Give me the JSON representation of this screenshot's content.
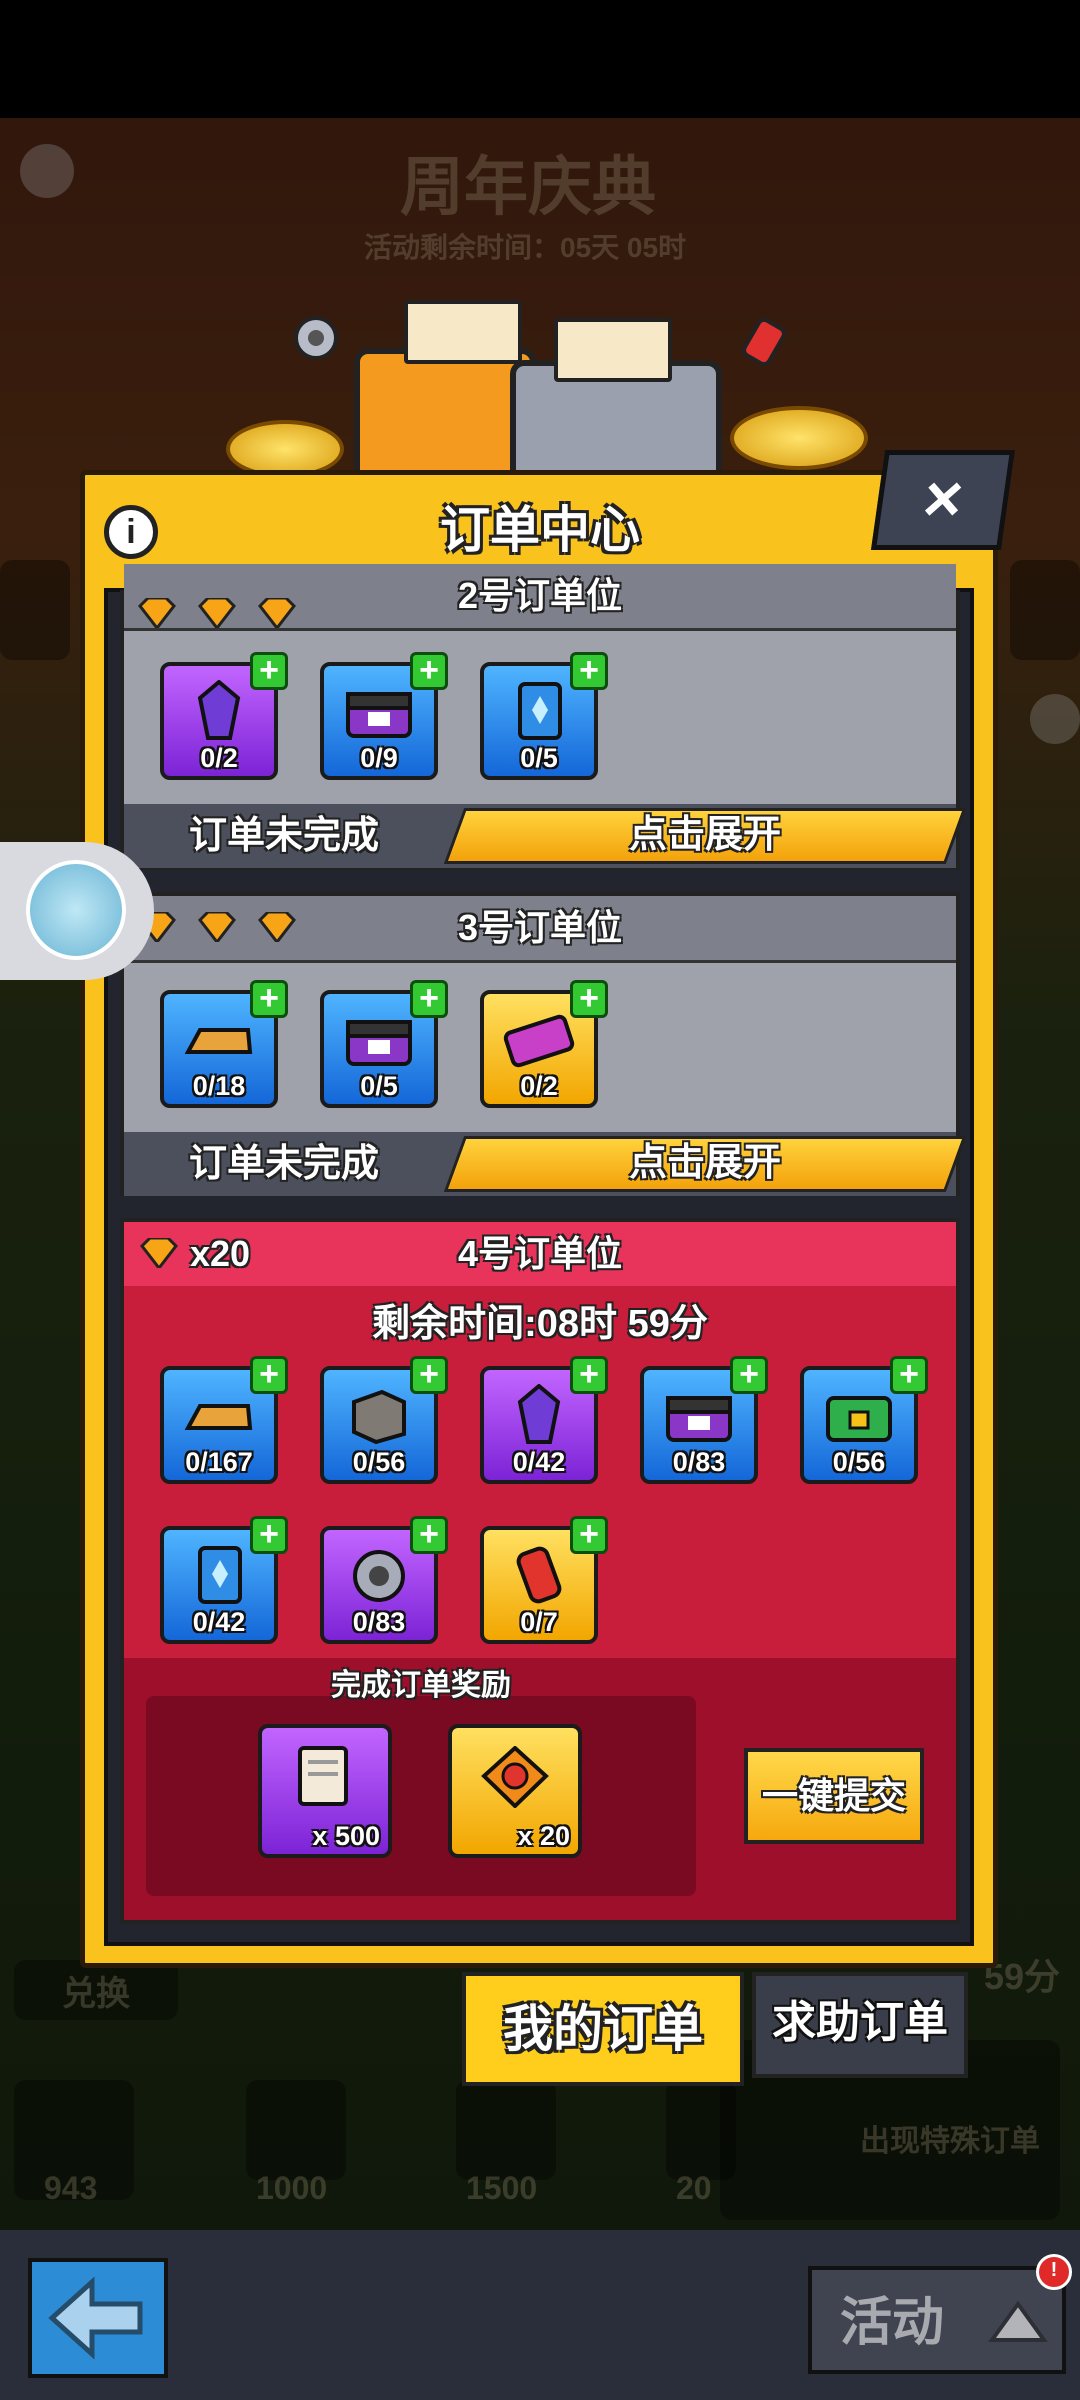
{
  "background": {
    "event_title": "周年庆典",
    "event_timer": "活动剩余时间：05天 05时",
    "side_labels": {
      "exchange": "兑换",
      "right_timer": "59分"
    },
    "bottom_values": [
      "943",
      "1000",
      "1500",
      "20"
    ],
    "special_order": "出现特殊订单"
  },
  "panel": {
    "title": "订单中心",
    "close_label": "×",
    "info_label": "i"
  },
  "orders": [
    {
      "title": "2号订单位",
      "gems": 3,
      "items": [
        {
          "icon": "crystal-icon",
          "color": "purple",
          "count": "0/2"
        },
        {
          "icon": "toolbox-icon",
          "color": "blue",
          "count": "0/9"
        },
        {
          "icon": "card-icon",
          "color": "blue",
          "count": "0/5"
        }
      ],
      "status": "订单未完成",
      "action": "点击展开"
    },
    {
      "title": "3号订单位",
      "gems": 3,
      "items": [
        {
          "icon": "gold-bar-icon",
          "color": "blue",
          "count": "0/18"
        },
        {
          "icon": "toolbox-icon",
          "color": "blue",
          "count": "0/5"
        },
        {
          "icon": "battery-icon",
          "color": "gold",
          "count": "0/2"
        }
      ],
      "status": "订单未完成",
      "action": "点击展开"
    }
  ],
  "active_order": {
    "title": "4号订单位",
    "gem_reward": "x20",
    "remaining_time": "剩余时间:08时 59分",
    "items": [
      {
        "icon": "gold-bar-icon",
        "color": "blue",
        "count": "0/167"
      },
      {
        "icon": "stone-block-icon",
        "color": "blue",
        "count": "0/56"
      },
      {
        "icon": "crystal-icon",
        "color": "purple",
        "count": "0/42"
      },
      {
        "icon": "toolbox-icon",
        "color": "blue",
        "count": "0/83"
      },
      {
        "icon": "green-chest-icon",
        "color": "blue",
        "count": "0/56"
      },
      {
        "icon": "card-icon",
        "color": "blue",
        "count": "0/42"
      },
      {
        "icon": "gear-icon",
        "color": "purple",
        "count": "0/83"
      },
      {
        "icon": "canister-icon",
        "color": "gold",
        "count": "0/7"
      }
    ],
    "reward_title": "完成订单奖励",
    "rewards": [
      {
        "icon": "document-icon",
        "color": "purple",
        "amount": "x 500"
      },
      {
        "icon": "badge-icon",
        "color": "gold",
        "amount": "x 20"
      }
    ],
    "submit_label": "一键提交"
  },
  "tabs": {
    "mine": "我的订单",
    "help": "求助订单"
  },
  "bottom_bar": {
    "activity": "活动",
    "notification": "!"
  },
  "colors": {
    "panel": "#f9c21c",
    "active_card": "#c81e3c",
    "plus": "#33c933",
    "gem": "#f7a417"
  }
}
